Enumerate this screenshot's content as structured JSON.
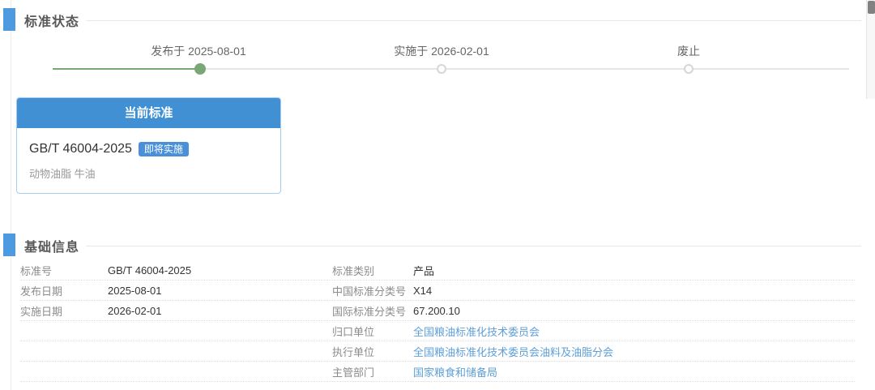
{
  "status_section": {
    "title": "标准状态",
    "timeline": [
      {
        "label": "发布于 2025-08-01",
        "state": "active"
      },
      {
        "label": "实施于 2026-02-01",
        "state": "pending"
      },
      {
        "label": "废止",
        "state": "pending"
      }
    ],
    "card": {
      "header": "当前标准",
      "standard_no": "GB/T 46004-2025",
      "badge": "即将实施",
      "name": "动物油脂 牛油"
    }
  },
  "info_section": {
    "title": "基础信息",
    "rows": [
      {
        "label1": "标准号",
        "value1": "GB/T 46004-2025",
        "label2": "标准类别",
        "value2": "产品"
      },
      {
        "label1": "发布日期",
        "value1": "2025-08-01",
        "label2": "中国标准分类号",
        "value2": "X14"
      },
      {
        "label1": "实施日期",
        "value1": "2026-02-01",
        "label2": "国际标准分类号",
        "value2": "67.200.10"
      },
      {
        "label1": "",
        "value1": "",
        "label2": "归口单位",
        "value2": "全国粮油标准化技术委员会"
      },
      {
        "label1": "",
        "value1": "",
        "label2": "执行单位",
        "value2": "全国粮油标准化技术委员会油料及油脂分会"
      },
      {
        "label1": "",
        "value1": "",
        "label2": "主管部门",
        "value2": "国家粮食和储备局"
      }
    ]
  },
  "colors": {
    "accent_blue": "#4090d3",
    "section_bar_blue": "#4d9ae0",
    "badge_blue": "#4a90d9",
    "link_blue": "#5e9fd8",
    "timeline_green": "#7aa874"
  }
}
